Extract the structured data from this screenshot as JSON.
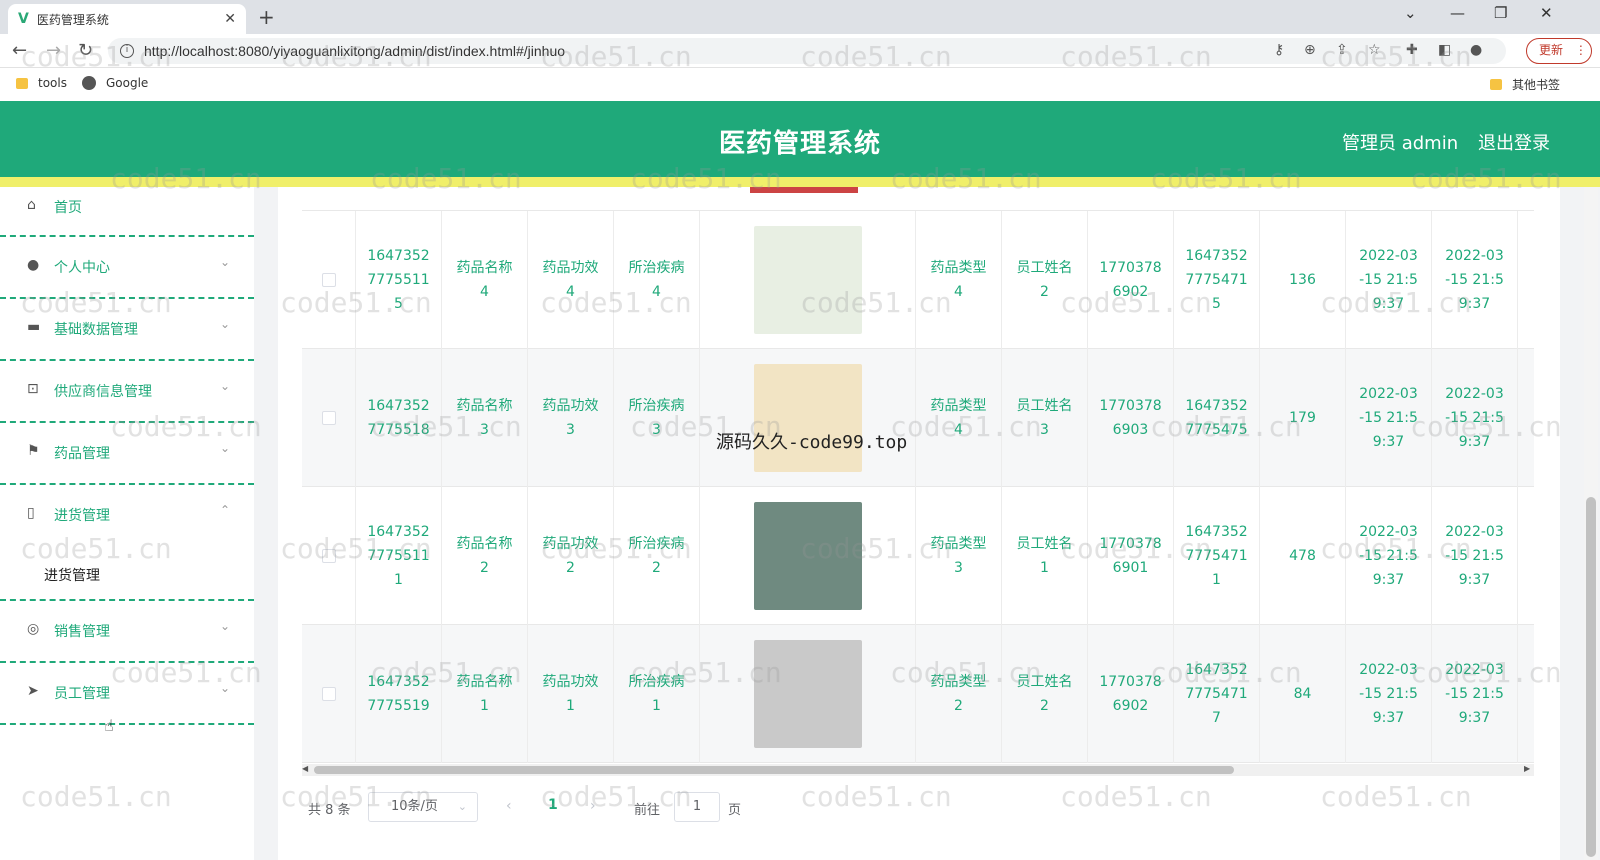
{
  "browser": {
    "tab_title": "医药管理系统",
    "tab_favicon": "V",
    "url": "http://localhost:8080/yiyaoguanlixitong/admin/dist/index.html#/jinhuo",
    "update_label": "更新",
    "bookmarks": [
      {
        "label": "tools",
        "icon": "folder-icon"
      },
      {
        "label": "Google",
        "icon": "globe-icon"
      }
    ],
    "other_bookmarks": "其他书签"
  },
  "header": {
    "title": "医药管理系统",
    "user": "管理员 admin",
    "logout": "退出登录",
    "color": "#1fa97a",
    "strip_color": "#f0ef6a"
  },
  "sidebar": {
    "items": [
      {
        "label": "首页",
        "icon": "home-icon",
        "glyph": "⌂"
      },
      {
        "label": "个人中心",
        "icon": "user-icon",
        "glyph": "●"
      },
      {
        "label": "基础数据管理",
        "icon": "monitor-icon",
        "glyph": "▬"
      },
      {
        "label": "供应商信息管理",
        "icon": "crop-icon",
        "glyph": "⊡"
      },
      {
        "label": "药品管理",
        "icon": "flag-icon",
        "glyph": "⚑"
      },
      {
        "label": "进货管理",
        "icon": "phone-icon",
        "glyph": "▯"
      },
      {
        "label": "销售管理",
        "icon": "settings-icon",
        "glyph": "◎"
      },
      {
        "label": "员工管理",
        "icon": "send-icon",
        "glyph": "➤"
      }
    ],
    "submenu": "进货管理"
  },
  "table": {
    "rows": [
      {
        "id": "1647352\n7775511\n5",
        "name": "药品名称\n4",
        "effect": "药品功效\n4",
        "disease": "所治疾病\n4",
        "type": "药品类型\n4",
        "staff": "员工姓名\n2",
        "phone": "1770378\n6902",
        "order": "1647352\n7775471\n5",
        "qty": "136",
        "date1": "2022-03\n-15 21:5\n9:37",
        "date2": "2022-03\n-15 21:5\n9:37",
        "img_color": "#e8efe3"
      },
      {
        "id": "1647352\n7775518",
        "name": "药品名称\n3",
        "effect": "药品功效\n3",
        "disease": "所治疾病\n3",
        "type": "药品类型\n4",
        "staff": "员工姓名\n3",
        "phone": "1770378\n6903",
        "order": "1647352\n7775475",
        "qty": "179",
        "date1": "2022-03\n-15 21:5\n9:37",
        "date2": "2022-03\n-15 21:5\n9:37",
        "img_color": "#f2e4c4"
      },
      {
        "id": "1647352\n7775511\n1",
        "name": "药品名称\n2",
        "effect": "药品功效\n2",
        "disease": "所治疾病\n2",
        "type": "药品类型\n3",
        "staff": "员工姓名\n1",
        "phone": "1770378\n6901",
        "order": "1647352\n7775471\n1",
        "qty": "478",
        "date1": "2022-03\n-15 21:5\n9:37",
        "date2": "2022-03\n-15 21:5\n9:37",
        "img_color": "#6f8a80"
      },
      {
        "id": "1647352\n7775519",
        "name": "药品名称\n1",
        "effect": "药品功效\n1",
        "disease": "所治疾病\n1",
        "type": "药品类型\n2",
        "staff": "员工姓名\n2",
        "phone": "1770378\n6902",
        "order": "1647352\n7775471\n7",
        "qty": "84",
        "date1": "2022-03\n-15 21:5\n9:37",
        "date2": "2022-03\n-15 21:5\n9:37",
        "img_color": "#c9c9c9"
      }
    ]
  },
  "pagination": {
    "total": "共 8 条",
    "page_size": "10条/页",
    "current_page": "1",
    "goto_label": "前往",
    "goto_value": "1",
    "page_suffix": "页"
  },
  "watermark": {
    "text": "code51.cn",
    "center_text": "源码久久-code99.top"
  }
}
